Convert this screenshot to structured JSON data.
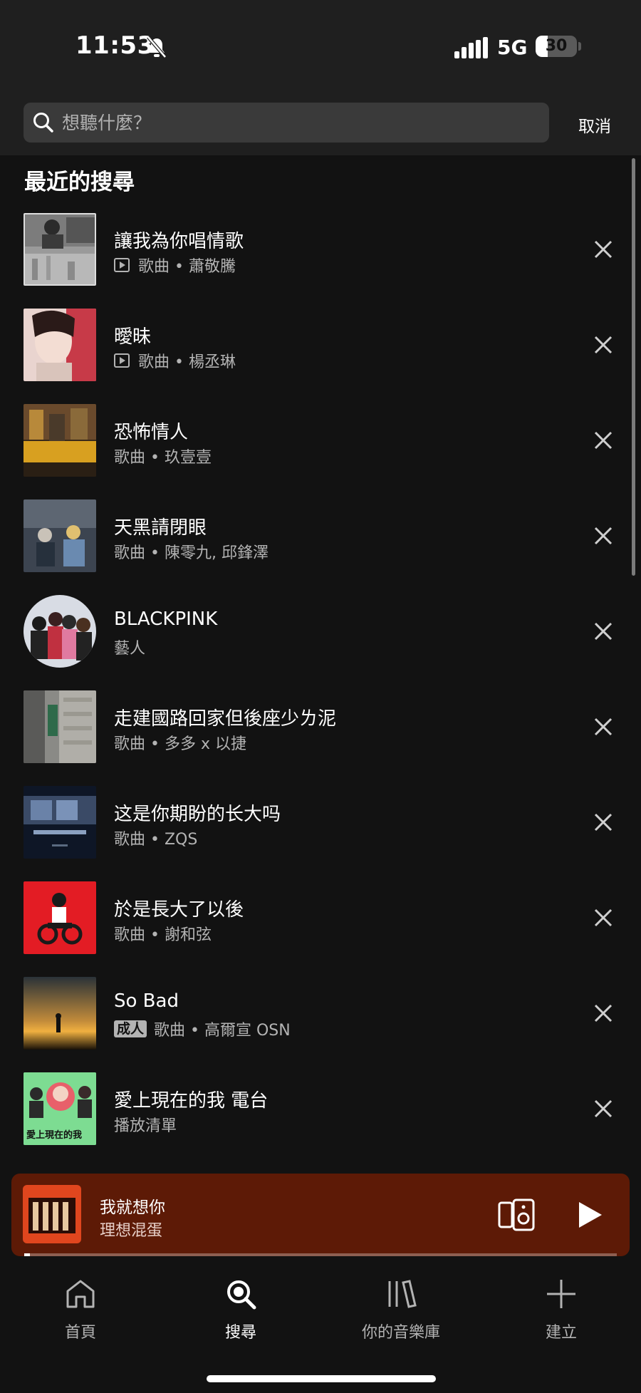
{
  "status_bar": {
    "time": "11:53",
    "network": "5G",
    "battery": "30",
    "battery_level": 0.3
  },
  "search": {
    "placeholder": "想聽什麼？",
    "cancel_label": "取消"
  },
  "recent": {
    "title": "最近的搜尋",
    "items": [
      {
        "title": "讓我為你唱情歌",
        "subtitle": "歌曲 • 蕭敬騰",
        "has_video": true,
        "explicit": false
      },
      {
        "title": "曖昧",
        "subtitle": "歌曲 • 楊丞琳",
        "has_video": true,
        "explicit": false
      },
      {
        "title": "恐怖情人",
        "subtitle": "歌曲 • 玖壹壹",
        "has_video": false,
        "explicit": false
      },
      {
        "title": "天黑請閉眼",
        "subtitle": "歌曲 • 陳零九, 邱鋒澤",
        "has_video": false,
        "explicit": false
      },
      {
        "title": "BLACKPINK",
        "subtitle": "藝人",
        "has_video": false,
        "explicit": false
      },
      {
        "title": "走建國路回家但後座少ㄌ泥",
        "subtitle": "歌曲 • 多多 x 以捷",
        "has_video": false,
        "explicit": false
      },
      {
        "title": "这是你期盼的长大吗",
        "subtitle": "歌曲 • ZQS",
        "has_video": false,
        "explicit": false
      },
      {
        "title": "於是長大了以後",
        "subtitle": "歌曲 • 謝和弦",
        "has_video": false,
        "explicit": false
      },
      {
        "title": "So Bad",
        "subtitle": "歌曲 • 高爾宣 OSN",
        "has_video": false,
        "explicit": true,
        "explicit_label": "成人"
      },
      {
        "title": "愛上現在的我 電台",
        "subtitle": "播放清單",
        "has_video": false,
        "explicit": false,
        "thumb_text": "愛上現在的我"
      }
    ]
  },
  "now_playing": {
    "title": "我就想你",
    "artist": "理想混蛋",
    "progress": 0.01
  },
  "nav": [
    {
      "label": "首頁",
      "icon": "home-icon"
    },
    {
      "label": "搜尋",
      "icon": "search-icon"
    },
    {
      "label": "你的音樂庫",
      "icon": "library-icon"
    },
    {
      "label": "建立",
      "icon": "plus-icon"
    }
  ],
  "colors": {
    "background": "#121212",
    "header": "#1f1f1f",
    "player": "#5d1a06",
    "muted_text": "#b3b3b3"
  }
}
